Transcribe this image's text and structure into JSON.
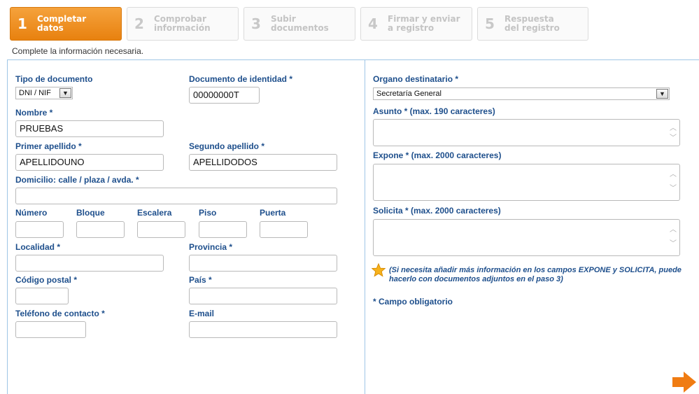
{
  "steps": [
    {
      "num": "1",
      "label": "Completar datos",
      "active": true
    },
    {
      "num": "2",
      "label": "Comprobar información",
      "active": false
    },
    {
      "num": "3",
      "label": "Subir documentos",
      "active": false
    },
    {
      "num": "4",
      "label": "Firmar y enviar a registro",
      "active": false
    },
    {
      "num": "5",
      "label": "Respuesta del registro",
      "active": false
    }
  ],
  "hint": "Complete la información necesaria.",
  "left": {
    "tipo_label": "Tipo de documento",
    "tipo_value": "DNI / NIF",
    "doc_label": "Documento de identidad *",
    "doc_value": "00000000T",
    "nombre_label": "Nombre *",
    "nombre_value": "PRUEBAS",
    "apellido1_label": "Primer apellido *",
    "apellido1_value": "APELLIDOUNO",
    "apellido2_label": "Segundo apellido *",
    "apellido2_value": "APELLIDODOS",
    "domicilio_label": "Domicilio: calle / plaza / avda. *",
    "domicilio_value": "",
    "numero_label": "Número",
    "bloque_label": "Bloque",
    "escalera_label": "Escalera",
    "piso_label": "Piso",
    "puerta_label": "Puerta",
    "localidad_label": "Localidad *",
    "provincia_label": "Provincia *",
    "cp_label": "Código postal *",
    "pais_label": "País *",
    "telefono_label": "Teléfono de contacto *",
    "email_label": "E-mail"
  },
  "right": {
    "organo_label": "Organo destinatario *",
    "organo_value": "Secretaría General",
    "asunto_label": "Asunto * (max. 190 caracteres)",
    "expone_label": "Expone * (max. 2000 caracteres)",
    "solicita_label": "Solicita * (max. 2000 caracteres)",
    "note": "(Si necesita añadir más información en los campos EXPONE y SOLICITA, puede hacerlo con documentos adjuntos en el paso 3)",
    "required_note": "* Campo obligatorio"
  },
  "icons": {
    "dropdown": "▾",
    "star": "star-icon",
    "next": "next-arrow-icon",
    "scroll_up": "︿",
    "scroll_down": "﹀"
  },
  "colors": {
    "accent_orange": "#e8810f",
    "label_blue": "#1e4f8c",
    "panel_border": "#9fc6e6"
  }
}
